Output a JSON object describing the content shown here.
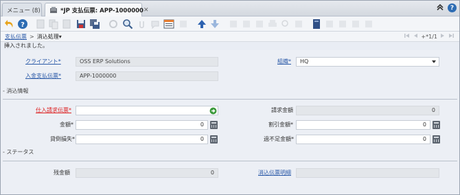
{
  "tabs": {
    "menu_label": "メニュー (8)",
    "active_label": "*JP 支払伝票: APP-1000000",
    "close_glyph": "✕"
  },
  "toolbar": {
    "icons": [
      "undo-icon",
      "help-icon",
      "new-icon",
      "copy-icon",
      "delete-icon",
      "save-icon",
      "save-new-icon",
      "refresh-icon",
      "find-icon",
      "attachment-icon",
      "chat-icon",
      "grid-toggle-icon",
      "parent-icon",
      "detail-icon",
      "history-icon",
      "home-icon",
      "product-info-icon",
      "report-icon",
      "print-icon",
      "zoom-across-icon",
      "workflow-icon",
      "archive-icon",
      "requests-icon",
      "lock-icon",
      "process-icon",
      "customize-icon"
    ]
  },
  "breadcrumb": {
    "parent": "支払伝票",
    "separator": ">",
    "current": "消込処理",
    "dropdown_glyph": "▾",
    "record_count": "+*1/1"
  },
  "message": "挿入されました。",
  "form": {
    "client_label": "クライアント",
    "client_value": "OSS ERP Solutions",
    "org_label": "組織",
    "org_value": "HQ",
    "payment_label": "入金支払伝票",
    "payment_value": "APP-1000000",
    "section_allocation": "- 消込情報",
    "invoice_label": "仕入請求伝票",
    "invoice_value": "",
    "invoice_amount_label": "請求金額",
    "invoice_amount_value": "0",
    "amount_label": "金額",
    "amount_value": "0",
    "discount_label": "割引金額",
    "discount_value": "0",
    "writeoff_label": "貸倒損失",
    "writeoff_value": "0",
    "overunder_label": "過不足金額",
    "overunder_value": "0",
    "section_status": "- ステータス",
    "remaining_label": "残金額",
    "remaining_value": "0",
    "allocation_line_label": "消込伝票明細",
    "allocation_line_value": "",
    "required_mark": "*"
  },
  "colors": {
    "link": "#2b5aa8",
    "required": "#dd2222",
    "tab_active_bg": "#f7f8fa",
    "form_bg": "#eceff5"
  }
}
